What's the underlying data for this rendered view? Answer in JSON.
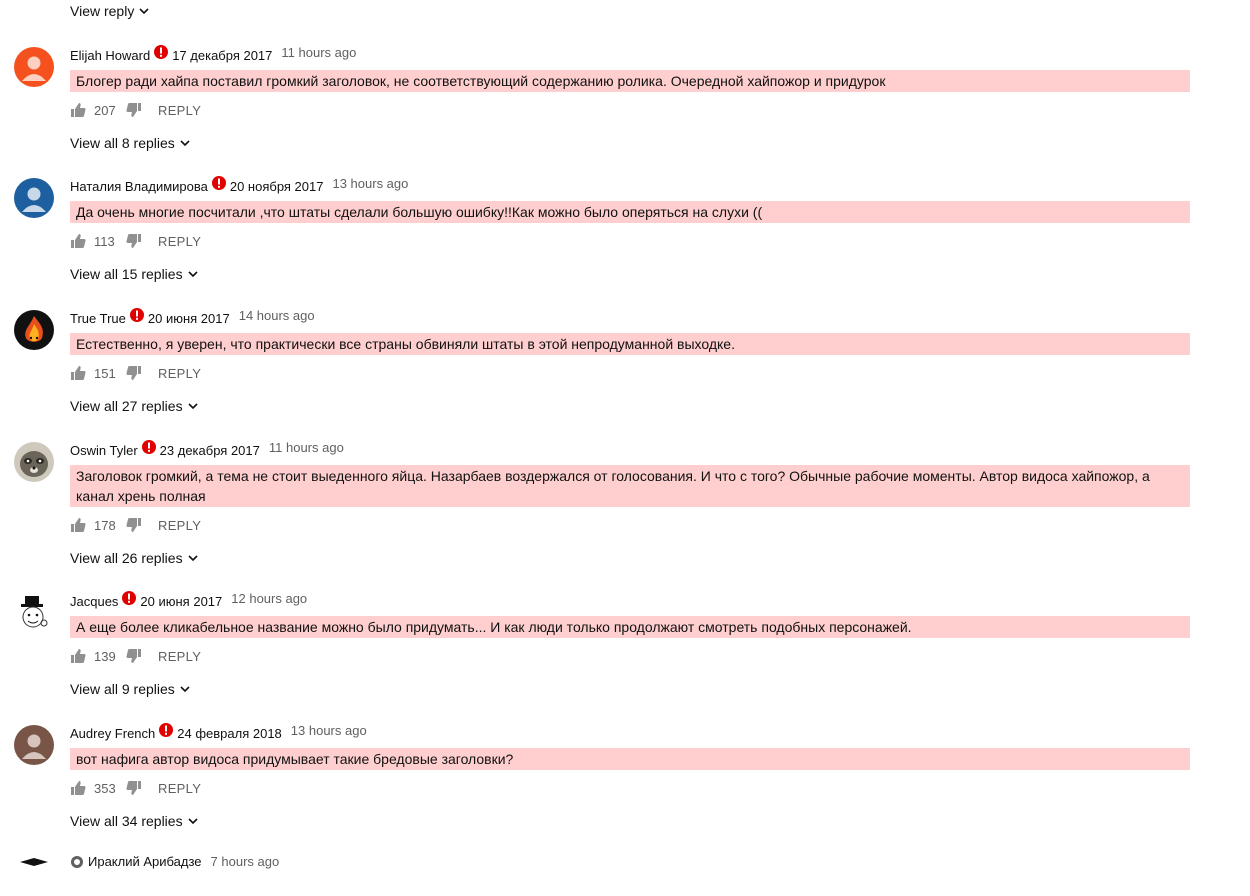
{
  "top_reply": {
    "label": "View reply"
  },
  "comments": [
    {
      "author": "Elijah Howard",
      "date": "17 декабря 2017",
      "time": "11 hours ago",
      "text": "Блогер ради хайпа поставил громкий заголовок, не соответствующий содержанию ролика. Очередной хайпожор и придурок",
      "likes": "207",
      "reply": "REPLY",
      "view_all": "View all 8 replies",
      "avatar_color": "#f4511e"
    },
    {
      "author": "Наталия Владимирова",
      "date": "20 ноября 2017",
      "time": "13 hours ago",
      "text": "Да очень многие посчитали ,что штаты сделали большую ошибку!!Как можно было оперяться на слухи ((",
      "likes": "113",
      "reply": "REPLY",
      "view_all": "View all 15 replies",
      "avatar_color": "#1e5fa0"
    },
    {
      "author": "True True",
      "date": "20 июня 2017",
      "time": "14 hours ago",
      "text": "Естественно, я уверен, что практически все страны обвиняли  штаты в этой непродуманной выходке.",
      "likes": "151",
      "reply": "REPLY",
      "view_all": "View all 27 replies",
      "avatar_color": "#111111"
    },
    {
      "author": "Oswin Tyler",
      "date": "23 декабря 2017",
      "time": "11 hours ago",
      "text": "Заголовок громкий, а тема не стоит выеденного яйца. Назарбаев воздержался от голосования. И что с того? Обычные рабочие моменты. Автор видоса хайпожор, а канал хрень полная",
      "likes": "178",
      "reply": "REPLY",
      "view_all": "View all 26 replies",
      "avatar_color": "#6b6458"
    },
    {
      "author": "Jacques",
      "date": "20 июня 2017",
      "time": "12 hours ago",
      "text": "А еще более кликабельное название можно было придумать... И как люди только продолжают смотреть подобных персонажей.",
      "likes": "139",
      "reply": "REPLY",
      "view_all": "View all 9 replies",
      "avatar_color": "#ffffff"
    },
    {
      "author": "Audrey French",
      "date": "24 февраля 2018",
      "time": "13 hours ago",
      "text": "вот нафига автор видоса придумывает такие бредовые заголовки?",
      "likes": "353",
      "reply": "REPLY",
      "view_all": "View all 34 replies",
      "avatar_color": "#795548"
    }
  ],
  "partial_comment": {
    "author": "Ираклий Арибадзе",
    "time": "7 hours ago"
  },
  "colors": {
    "highlight": "#ffcfcf",
    "flag": "#e00000",
    "muted": "#606060"
  }
}
